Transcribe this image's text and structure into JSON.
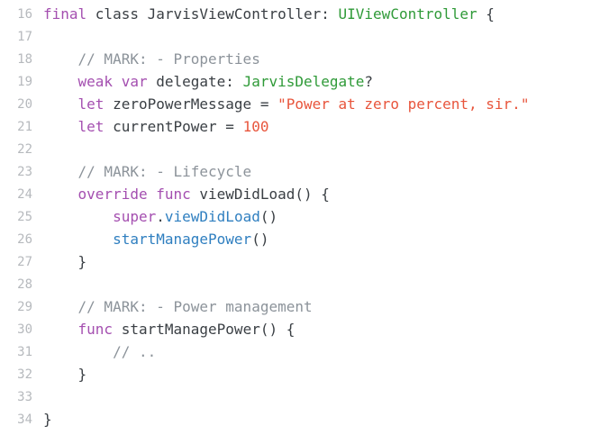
{
  "lines": [
    {
      "n": "16",
      "t": [
        [
          "kw",
          "final "
        ],
        [
          "plain",
          "class "
        ],
        [
          "plain",
          "JarvisViewController: "
        ],
        [
          "type",
          "UIViewController"
        ],
        [
          "plain",
          " {"
        ]
      ]
    },
    {
      "n": "17",
      "t": []
    },
    {
      "n": "18",
      "t": [
        [
          "cmt",
          "    // MARK: - Properties"
        ]
      ]
    },
    {
      "n": "19",
      "t": [
        [
          "kw",
          "    weak var "
        ],
        [
          "plain",
          "delegate: "
        ],
        [
          "type",
          "JarvisDelegate"
        ],
        [
          "plain",
          "?"
        ]
      ]
    },
    {
      "n": "20",
      "t": [
        [
          "kw",
          "    let "
        ],
        [
          "plain",
          "zeroPowerMessage = "
        ],
        [
          "str",
          "\"Power at zero percent, sir.\""
        ]
      ]
    },
    {
      "n": "21",
      "t": [
        [
          "kw",
          "    let "
        ],
        [
          "plain",
          "currentPower = "
        ],
        [
          "num",
          "100"
        ]
      ]
    },
    {
      "n": "22",
      "t": []
    },
    {
      "n": "23",
      "t": [
        [
          "cmt",
          "    // MARK: - Lifecycle"
        ]
      ]
    },
    {
      "n": "24",
      "t": [
        [
          "kw",
          "    override func "
        ],
        [
          "plain",
          "viewDidLoad() {"
        ]
      ]
    },
    {
      "n": "25",
      "t": [
        [
          "kw",
          "        super"
        ],
        [
          "plain",
          "."
        ],
        [
          "fn",
          "viewDidLoad"
        ],
        [
          "plain",
          "()"
        ]
      ]
    },
    {
      "n": "26",
      "t": [
        [
          "fn",
          "        startManagePower"
        ],
        [
          "plain",
          "()"
        ]
      ]
    },
    {
      "n": "27",
      "t": [
        [
          "plain",
          "    }"
        ]
      ]
    },
    {
      "n": "28",
      "t": []
    },
    {
      "n": "29",
      "t": [
        [
          "cmt",
          "    // MARK: - Power management"
        ]
      ]
    },
    {
      "n": "30",
      "t": [
        [
          "kw",
          "    func "
        ],
        [
          "plain",
          "startManagePower() {"
        ]
      ]
    },
    {
      "n": "31",
      "t": [
        [
          "cmt",
          "        // .."
        ]
      ]
    },
    {
      "n": "32",
      "t": [
        [
          "plain",
          "    }"
        ]
      ]
    },
    {
      "n": "33",
      "t": []
    },
    {
      "n": "34",
      "t": [
        [
          "plain",
          "}"
        ]
      ]
    }
  ]
}
